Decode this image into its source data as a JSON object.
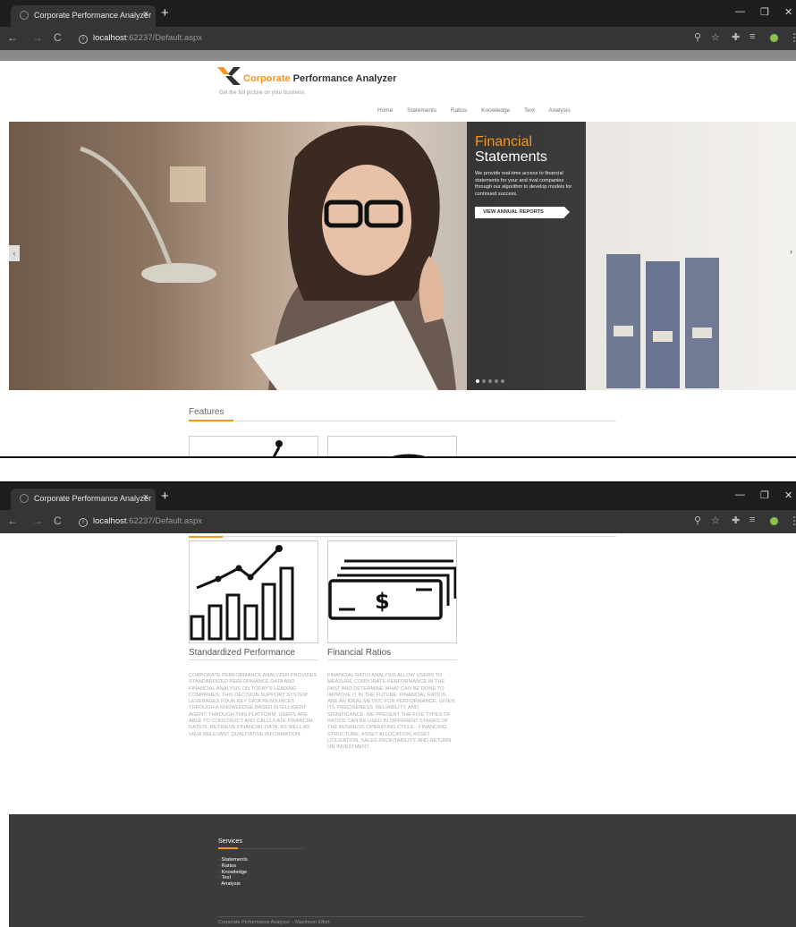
{
  "browser": {
    "tab_title": "Corporate Performance Analyzer",
    "tab_close": "×",
    "new_tab": "+",
    "url_host": "localhost",
    "url_rest": ":62237/Default.aspx",
    "icons": [
      "back-icon",
      "forward-icon",
      "reload-icon",
      "info-icon",
      "zoom-icon",
      "star-icon",
      "extensions-icon",
      "media-icon",
      "menu-icon"
    ]
  },
  "site": {
    "brand_orange": "Corporate",
    "brand_rest": "Performance Analyzer",
    "tagline": "Get the full picture on your business",
    "nav": [
      "Home",
      "Statements",
      "Ratios",
      "Knowledge",
      "Text",
      "Analysis"
    ]
  },
  "hero": {
    "heading_orange": "Financial",
    "heading_white": "Statements",
    "body": "We provide real-time access to financial statements for your and rival companies through our algorithm to develop models for continued success.",
    "button": "VIEW ANNUAL REPORTS",
    "slide_count": 5,
    "active_slide": 1,
    "prev": "‹",
    "next": "›"
  },
  "features": {
    "title": "Features",
    "cards": [
      {
        "title": "Standardized Performance",
        "text": "Corporate Performance Analyzer provides standardized performance data and financial analysis on today's leading companies. This decision support system leverages four key data resources through a knowledge-based intelligent agent. Through this platform, users are able to construct and calculate financial ratios, retrieve financial data, as well as view relevant qualitative information."
      },
      {
        "title": "Financial Ratios",
        "text": "Financial ratio analysis allow users to measure corporate performance in the past and determine what can be done to improve it in the future. Financial ratios are an ideal metric for performance, given its preciseness, reliability, and significance. We present the five types of ratios can be used in different stages of the business operating cycle - financing structure, asset allocation, asset utilization, sales profitability, and return on investment."
      }
    ]
  },
  "footer": {
    "title": "Services",
    "links": [
      "Statements",
      "Ratios",
      "Knowledge",
      "Text",
      "Analysis"
    ],
    "copyright": "Corporate Performance Analyzer – Maximum Effort"
  },
  "colors": {
    "accent": "#f7941d",
    "footer_bg": "#3b3b3b",
    "chrome_bg": "#1e1e1e"
  }
}
